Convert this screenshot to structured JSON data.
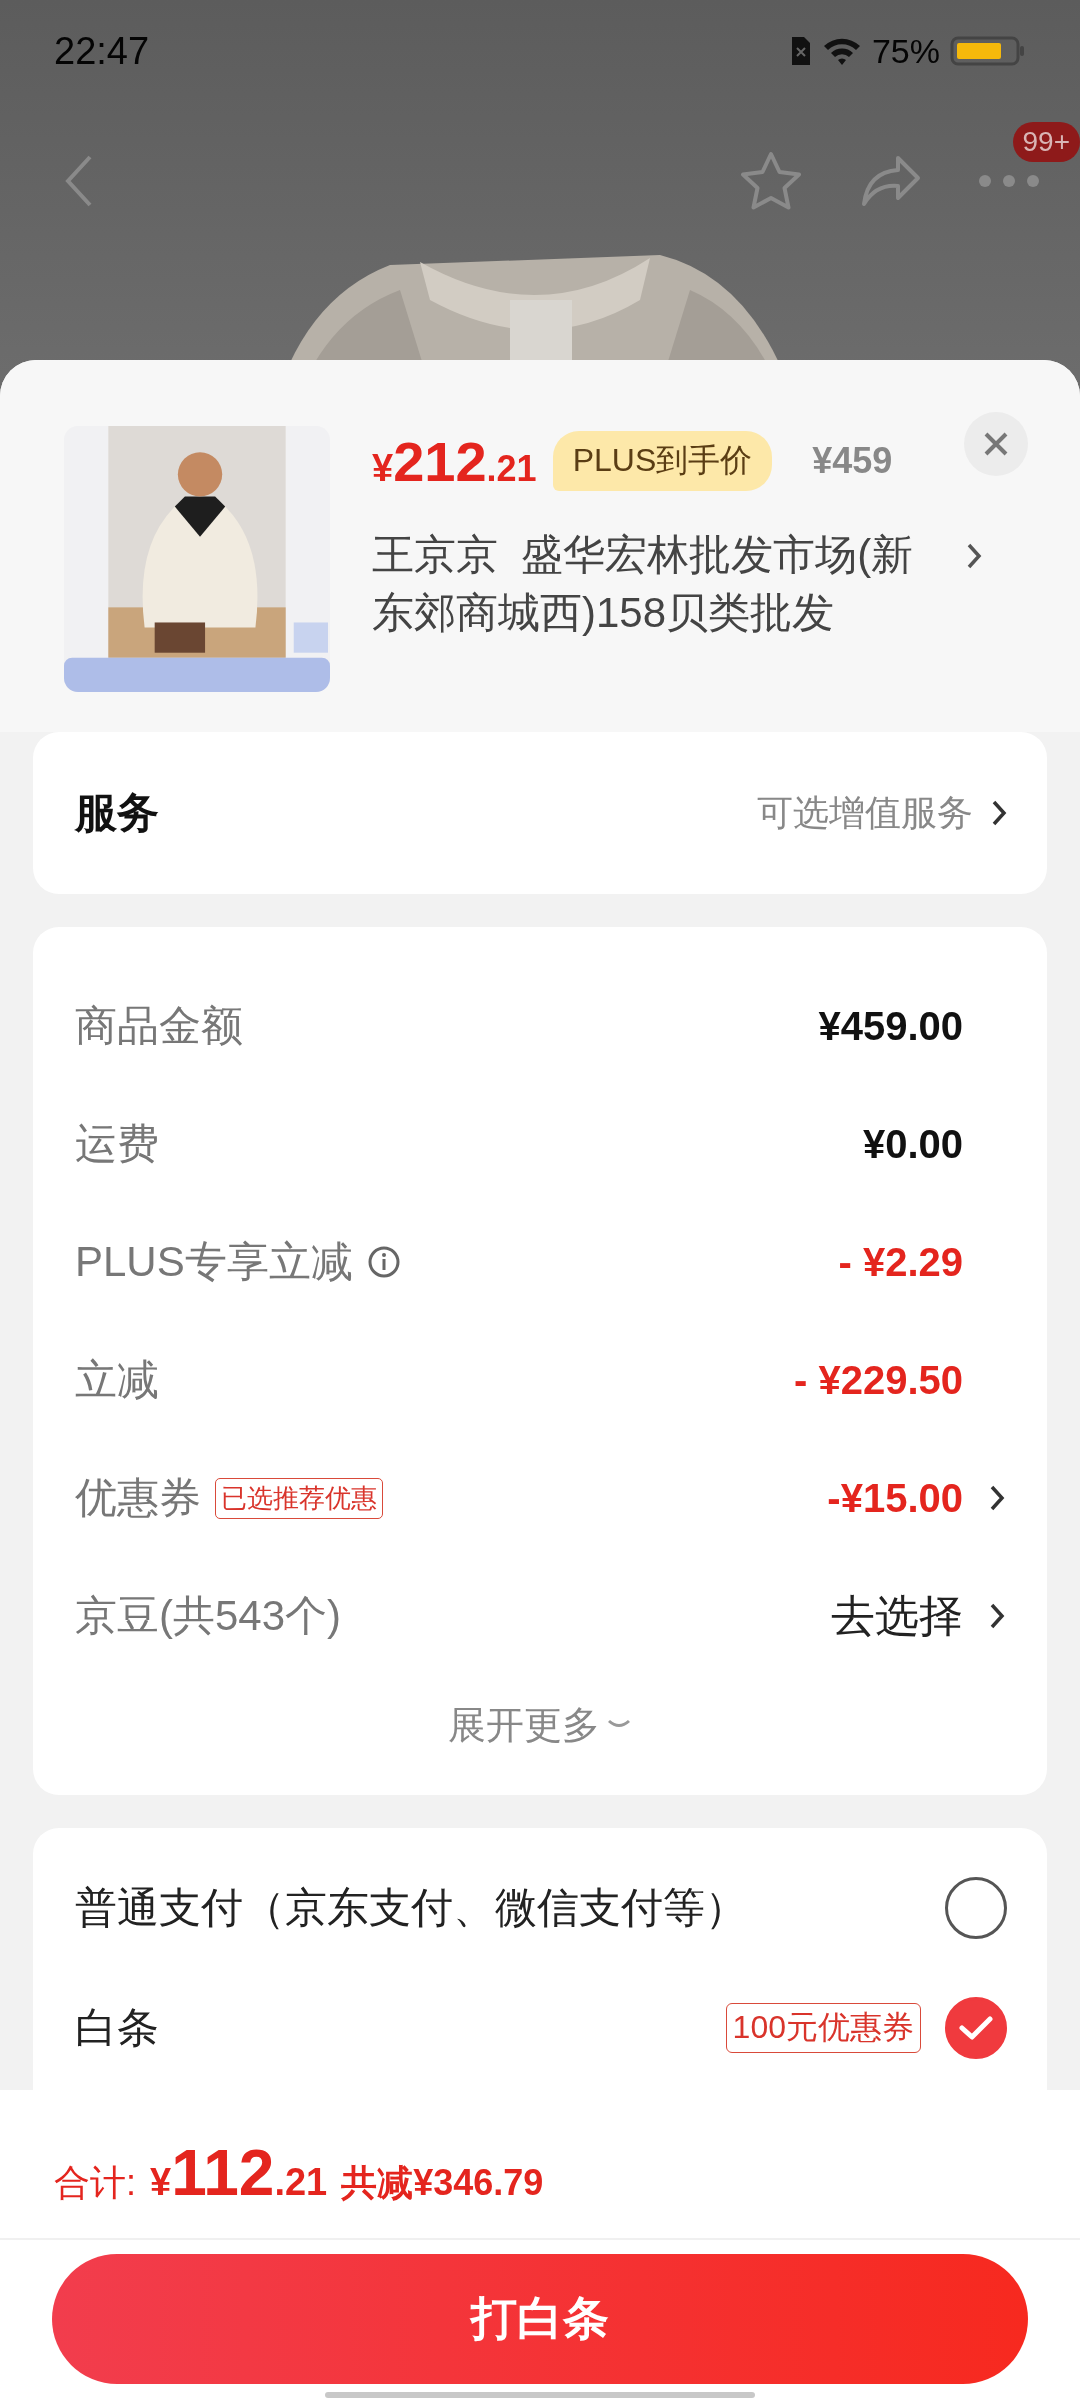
{
  "status_bar": {
    "time": "22:47",
    "battery": "75%"
  },
  "nav": {
    "badge": "99+"
  },
  "product": {
    "currency": "¥",
    "price_main": "212",
    "price_decimal": ".21",
    "price_tag": "PLUS到手价",
    "original_price": "¥459",
    "title": "王京京  盛华宏林批发市场(新东郊商城西)158贝类批发"
  },
  "service": {
    "label": "服务",
    "value": "可选增值服务"
  },
  "fees": [
    {
      "label": "商品金额",
      "value": "¥459.00",
      "kind": "amount",
      "info": false,
      "chevron": false
    },
    {
      "label": "运费",
      "value": "¥0.00",
      "kind": "amount",
      "info": false,
      "chevron": false
    },
    {
      "label": "PLUS专享立减",
      "value": "- ¥2.29",
      "kind": "discount",
      "info": true,
      "chevron": false
    },
    {
      "label": "立减",
      "value": "- ¥229.50",
      "kind": "discount",
      "info": false,
      "chevron": false
    },
    {
      "label": "优惠券",
      "badge": "已选推荐优惠",
      "value": "-¥15.00",
      "kind": "discount",
      "info": false,
      "chevron": true
    },
    {
      "label": "京豆(共543个)",
      "value": "去选择",
      "kind": "link",
      "info": false,
      "chevron": true
    }
  ],
  "expand": "展开更多",
  "payments": [
    {
      "label": "普通支付（京东支付、微信支付等）",
      "selected": false
    },
    {
      "label": "白条",
      "badge": "100元优惠券",
      "selected": true
    }
  ],
  "total": {
    "label": "合计:",
    "currency": "¥",
    "amount_main": "112",
    "amount_decimal": ".21",
    "saved": "共减¥346.79"
  },
  "submit": "打白条"
}
